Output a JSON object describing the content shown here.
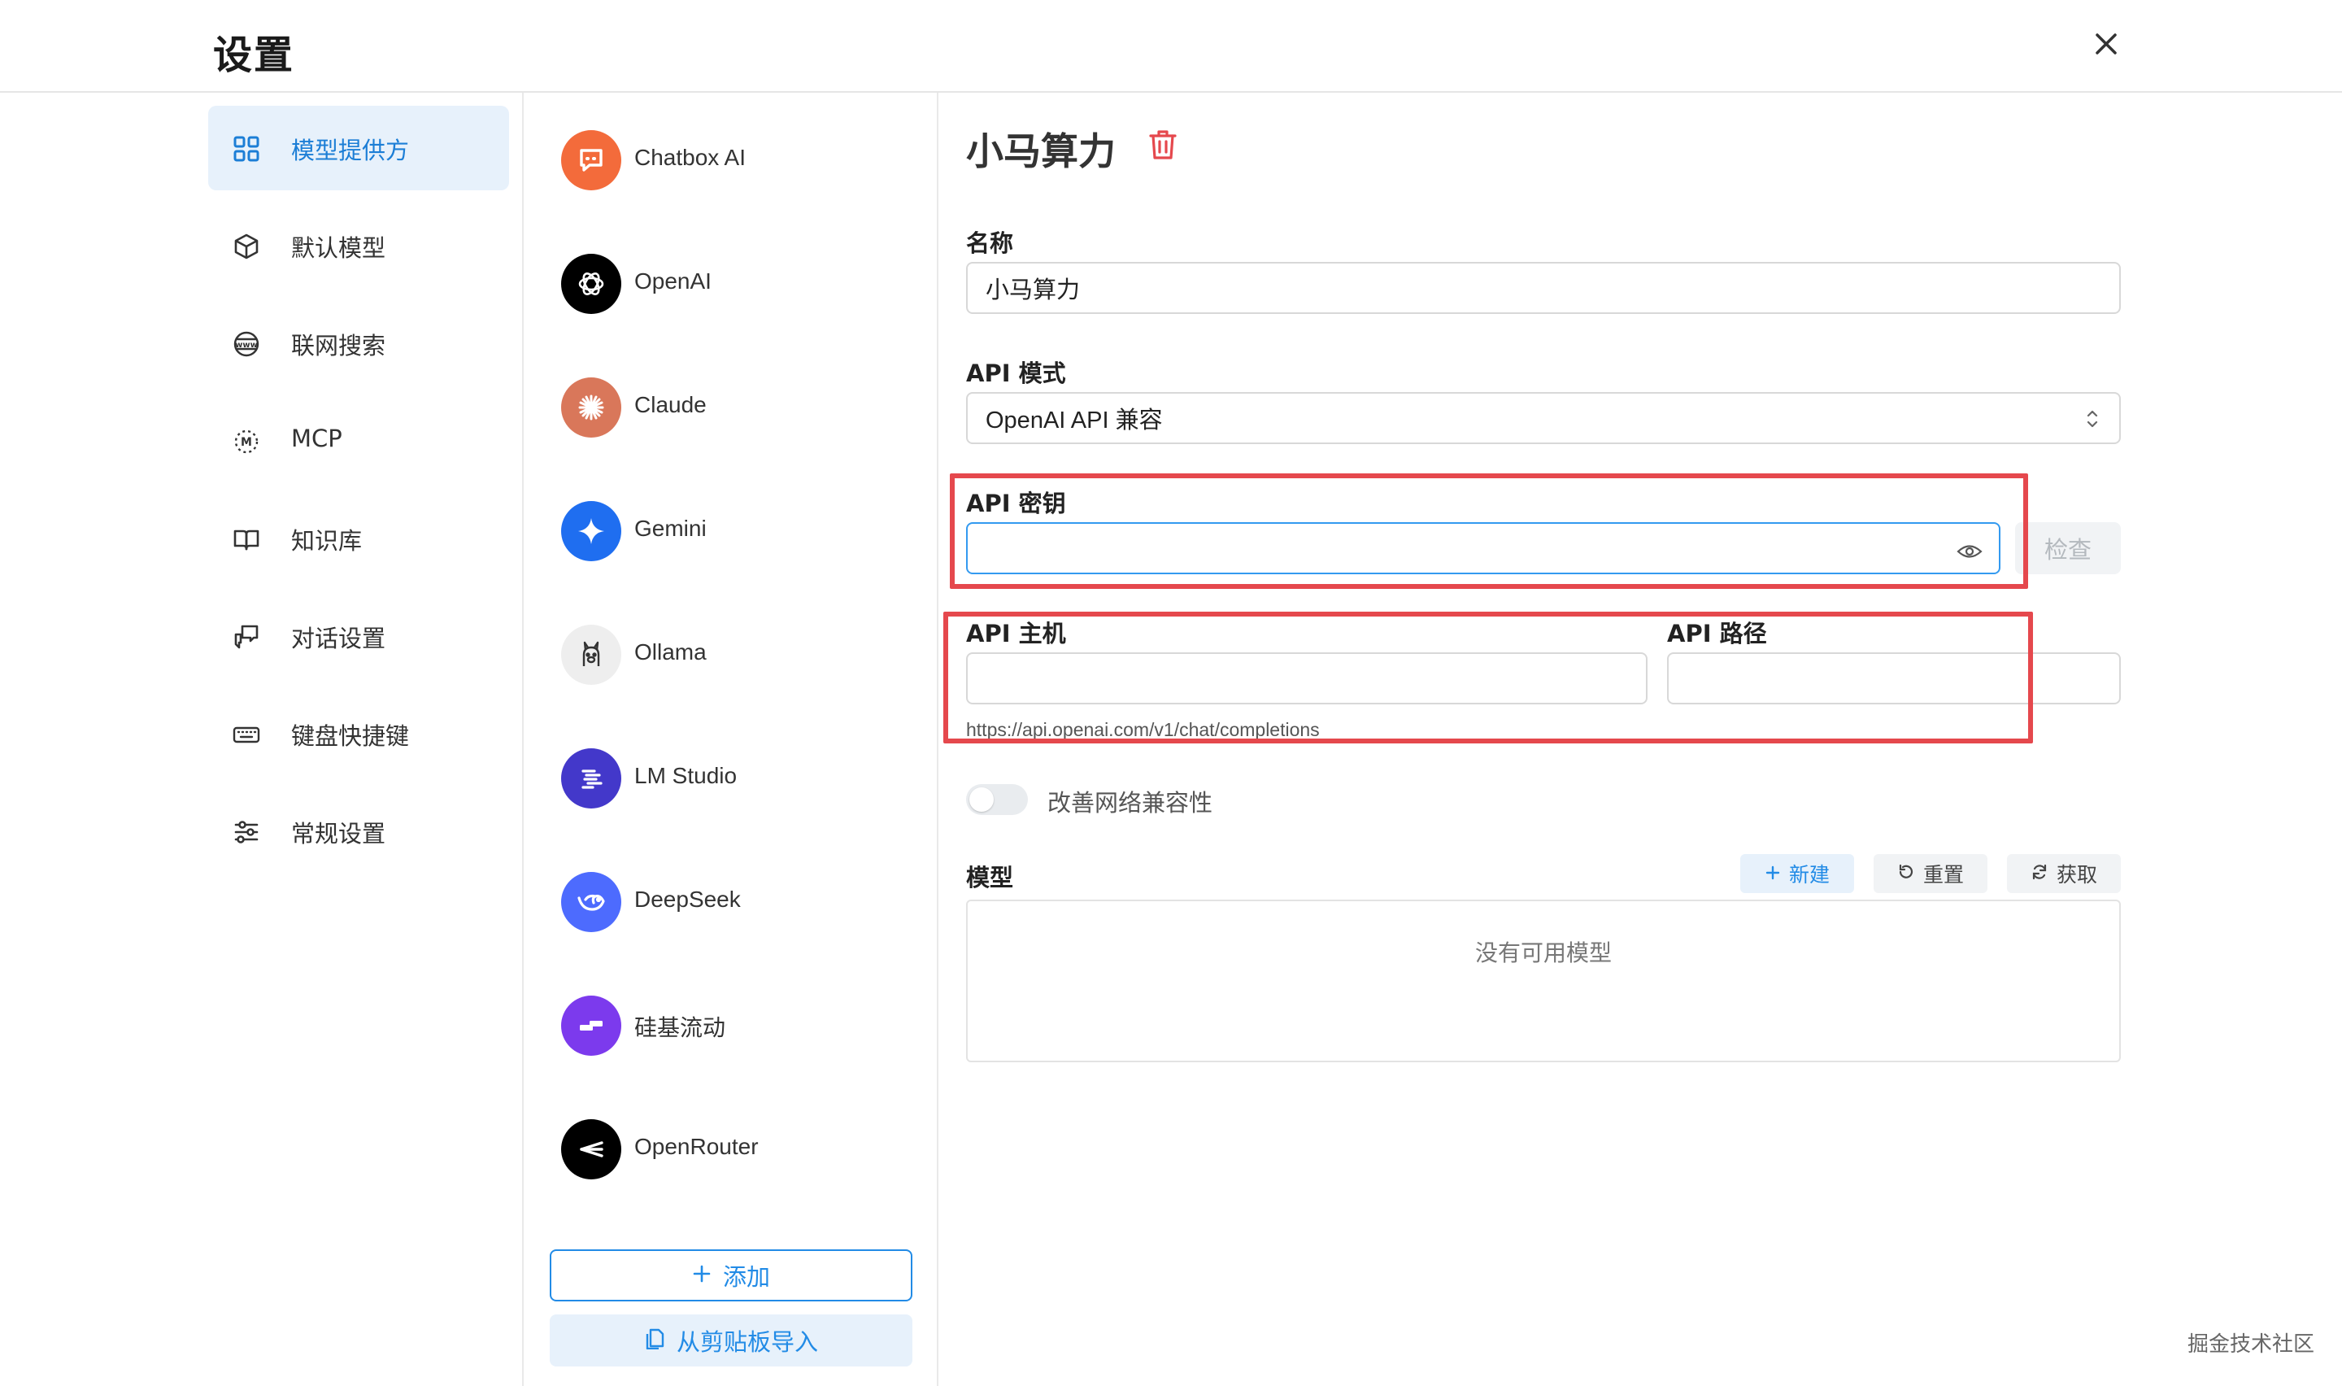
{
  "header": {
    "title": "设置"
  },
  "sidebar": {
    "items": [
      {
        "label": "模型提供方",
        "icon": "grid-icon",
        "active": true
      },
      {
        "label": "默认模型",
        "icon": "cube-icon"
      },
      {
        "label": "联网搜索",
        "icon": "globe-www-icon"
      },
      {
        "label": "MCP",
        "icon": "mcp-icon"
      },
      {
        "label": "知识库",
        "icon": "book-icon"
      },
      {
        "label": "对话设置",
        "icon": "chat-settings-icon"
      },
      {
        "label": "键盘快捷键",
        "icon": "keyboard-icon"
      },
      {
        "label": "常规设置",
        "icon": "sliders-icon"
      }
    ]
  },
  "providers": {
    "items": [
      {
        "name": "Chatbox AI",
        "color": "#f36b3b"
      },
      {
        "name": "OpenAI",
        "color": "#000000"
      },
      {
        "name": "Claude",
        "color": "#d9775a"
      },
      {
        "name": "Gemini",
        "color": "#1f6ef0"
      },
      {
        "name": "Ollama",
        "color": "#eeeeee"
      },
      {
        "name": "LM Studio",
        "color": "#4338ca"
      },
      {
        "name": "DeepSeek",
        "color": "#4d6bfe"
      },
      {
        "name": "硅基流动",
        "color": "#7c3aed"
      },
      {
        "name": "OpenRouter",
        "color": "#000000"
      }
    ],
    "add_label": "添加",
    "import_label": "从剪贴板导入"
  },
  "main": {
    "title": "小马算力",
    "name_label": "名称",
    "name_value": "小马算力",
    "api_mode_label": "API 模式",
    "api_mode_value": "OpenAI API 兼容",
    "api_key_label": "API 密钥",
    "api_key_value": "",
    "check_label": "检查",
    "api_host_label": "API 主机",
    "api_host_value": "",
    "api_path_label": "API 路径",
    "api_path_value": "",
    "host_hint": "https://api.openai.com/v1/chat/completions",
    "toggle_label": "改善网络兼容性",
    "toggle_on": false,
    "models_label": "模型",
    "new_label": "新建",
    "reset_label": "重置",
    "fetch_label": "获取",
    "models_empty": "没有可用模型"
  },
  "watermark": "掘金技术社区",
  "colors": {
    "accent": "#228be6",
    "danger": "#e5484d",
    "active_bg": "#e7f1fb"
  }
}
